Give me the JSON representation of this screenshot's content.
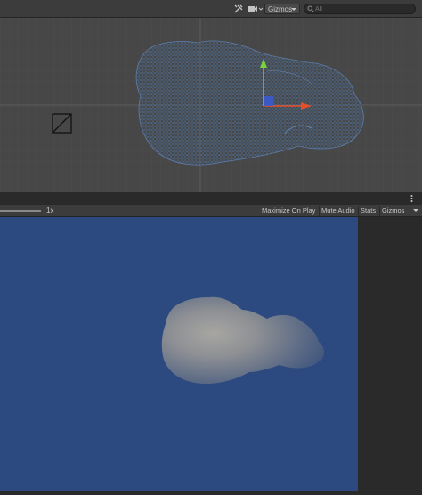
{
  "scene_toolbar": {
    "tools_icon": "tools-icon",
    "camera_icon": "camera-icon",
    "dropdown_icon": "chevron-down-icon",
    "gizmos_label": "Gizmos",
    "search": {
      "placeholder": "All",
      "value": "",
      "icon": "search-icon"
    }
  },
  "scene_view": {
    "grid_color": "#555555",
    "mesh_color": "#4d6f9c",
    "gizmo_x_color": "#e5502a",
    "gizmo_y_color": "#7ad33c",
    "gizmo_center_color": "#3a5ad6",
    "light_icon": "area-light-icon"
  },
  "divider": {
    "menu_icon": "more-options-icon"
  },
  "game_toolbar": {
    "scale_label": "1x",
    "maximize_on_play_label": "Maximize On Play",
    "mute_audio_label": "Mute Audio",
    "stats_label": "Stats",
    "gizmos_label": "Gizmos",
    "dropdown_icon": "chevron-down-icon"
  },
  "game_view": {
    "background_color": "#2c4a7f",
    "object": "cloud-mesh"
  }
}
